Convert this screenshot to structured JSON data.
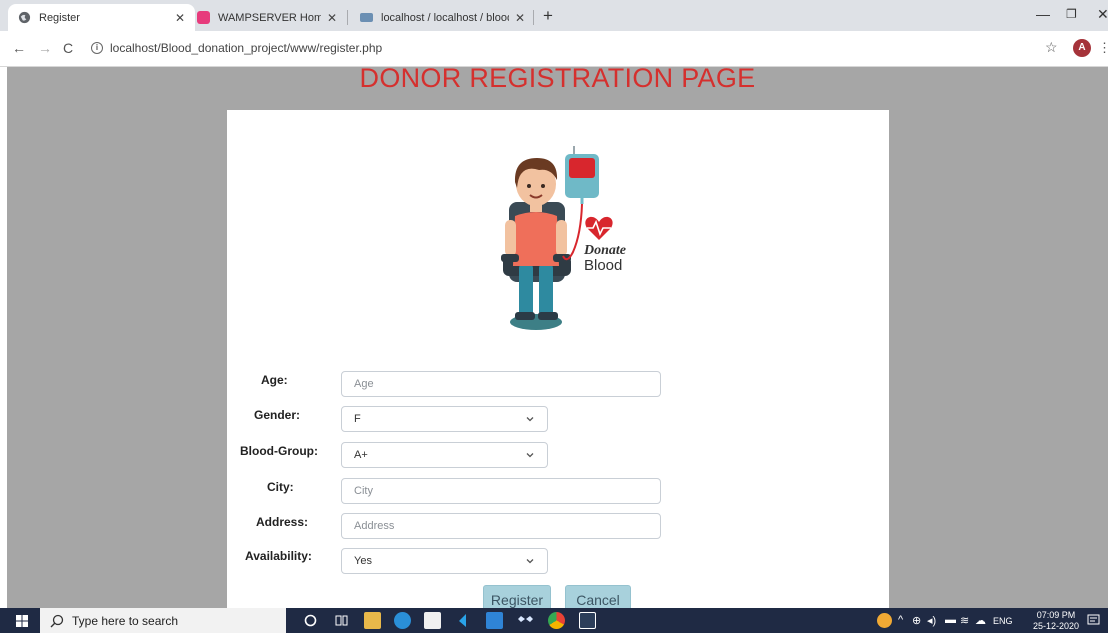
{
  "browser": {
    "tabs": [
      {
        "label": "Register",
        "favicon_color": "#5f6368",
        "active": true
      },
      {
        "label": "WAMPSERVER Homepage",
        "favicon_color": "#e73b7c",
        "active": false
      },
      {
        "label": "localhost / localhost / blood_mar",
        "favicon_color": "#6b8fb3",
        "active": false
      }
    ],
    "new_tab_symbol": "+",
    "url": "localhost/Blood_donation_project/www/register.php",
    "profile_initial": "A"
  },
  "page": {
    "heading": "DONOR REGISTRATION PAGE",
    "logo_text": {
      "line1": "Donate",
      "line2": "Blood"
    },
    "form": {
      "age": {
        "label": "Age:",
        "placeholder": "Age",
        "value": ""
      },
      "gender": {
        "label": "Gender:",
        "selected": "F"
      },
      "blood_group": {
        "label": "Blood-Group:",
        "selected": "A+"
      },
      "city": {
        "label": "City:",
        "placeholder": "City",
        "value": ""
      },
      "address": {
        "label": "Address:",
        "placeholder": "Address",
        "value": ""
      },
      "availability": {
        "label": "Availability:",
        "selected": "Yes"
      },
      "register_label": "Register",
      "cancel_label": "Cancel"
    }
  },
  "taskbar": {
    "search_placeholder": "Type here to search",
    "language": "ENG",
    "time": "07:09 PM",
    "date": "25-12-2020"
  },
  "colors": {
    "heading": "#d5302e",
    "page_background": "#a6a6a6",
    "button": "#a8d1dc",
    "taskbar": "#1f2a44"
  }
}
